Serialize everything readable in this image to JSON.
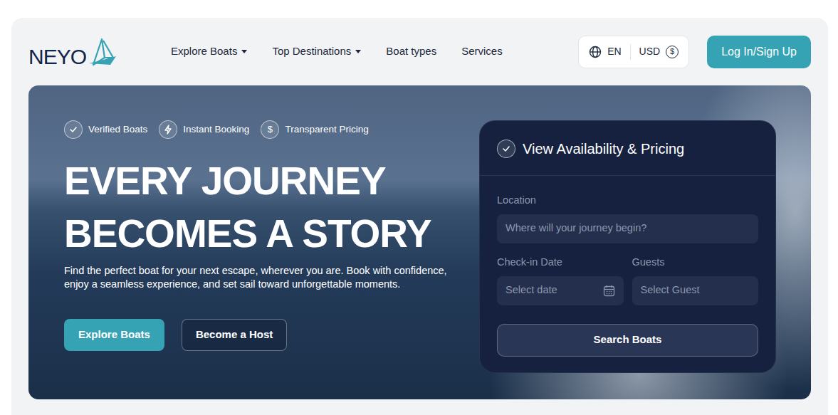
{
  "logo": "NEYO",
  "nav": [
    {
      "label": "Explore Boats",
      "dropdown": true
    },
    {
      "label": "Top Destinations",
      "dropdown": true
    },
    {
      "label": "Boat types",
      "dropdown": false
    },
    {
      "label": "Services",
      "dropdown": false
    }
  ],
  "language": "EN",
  "currency": "USD",
  "currency_symbol": "$",
  "login": "Log In/Sign Up",
  "hero": {
    "features": [
      {
        "label": "Verified Boats",
        "kind": "check",
        "glyph": ""
      },
      {
        "label": "Instant Booking",
        "kind": "bolt",
        "glyph": ""
      },
      {
        "label": "Transparent Pricing",
        "kind": "dollar",
        "glyph": "$"
      }
    ],
    "title": [
      "EVERY JOURNEY",
      "BECOMES A STORY"
    ],
    "description": "Find the perfect boat for your next escape, wherever you are. Book with confidence, enjoy a seamless experience, and set sail toward unforgettable moments.",
    "buttons": [
      "Explore Boats",
      "Become a Host"
    ]
  },
  "booking": {
    "title": "View Availability & Pricing",
    "location": {
      "label": "Location",
      "placeholder": "Where will your journey begin?"
    },
    "checkin": {
      "label": "Check-in Date",
      "placeholder": "Select date"
    },
    "guests": {
      "label": "Guests",
      "placeholder": "Select Guest"
    },
    "button": "Search Boats"
  }
}
